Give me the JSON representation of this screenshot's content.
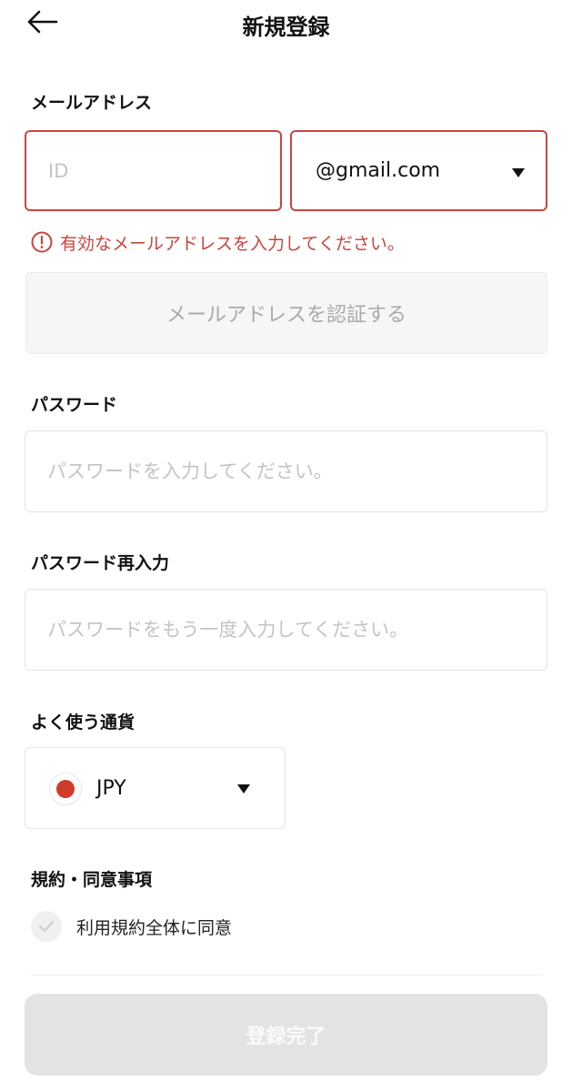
{
  "header": {
    "title": "新規登録",
    "back_icon": "arrow-left-icon"
  },
  "email": {
    "label": "メールアドレス",
    "id_placeholder": "ID",
    "id_value": "",
    "domain_value": "@gmail.com",
    "error_text": "有効なメールアドレスを入力してください。",
    "verify_button": "メールアドレスを認証する"
  },
  "password": {
    "label": "パスワード",
    "placeholder": "パスワードを入力してください。",
    "value": ""
  },
  "password_confirm": {
    "label": "パスワード再入力",
    "placeholder": "パスワードをもう一度入力してください。",
    "value": ""
  },
  "currency": {
    "label": "よく使う通貨",
    "value": "JPY",
    "flag_icon": "japan-flag-icon"
  },
  "terms": {
    "label": "規約・同意事項",
    "agree_all": "利用規約全体に同意",
    "checked": false
  },
  "submit_button": "登録完了",
  "colors": {
    "error": "#c8453e",
    "border": "#e4e4e4",
    "disabled_bg": "#e3e3e3",
    "flag_red": "#d13b2b"
  }
}
